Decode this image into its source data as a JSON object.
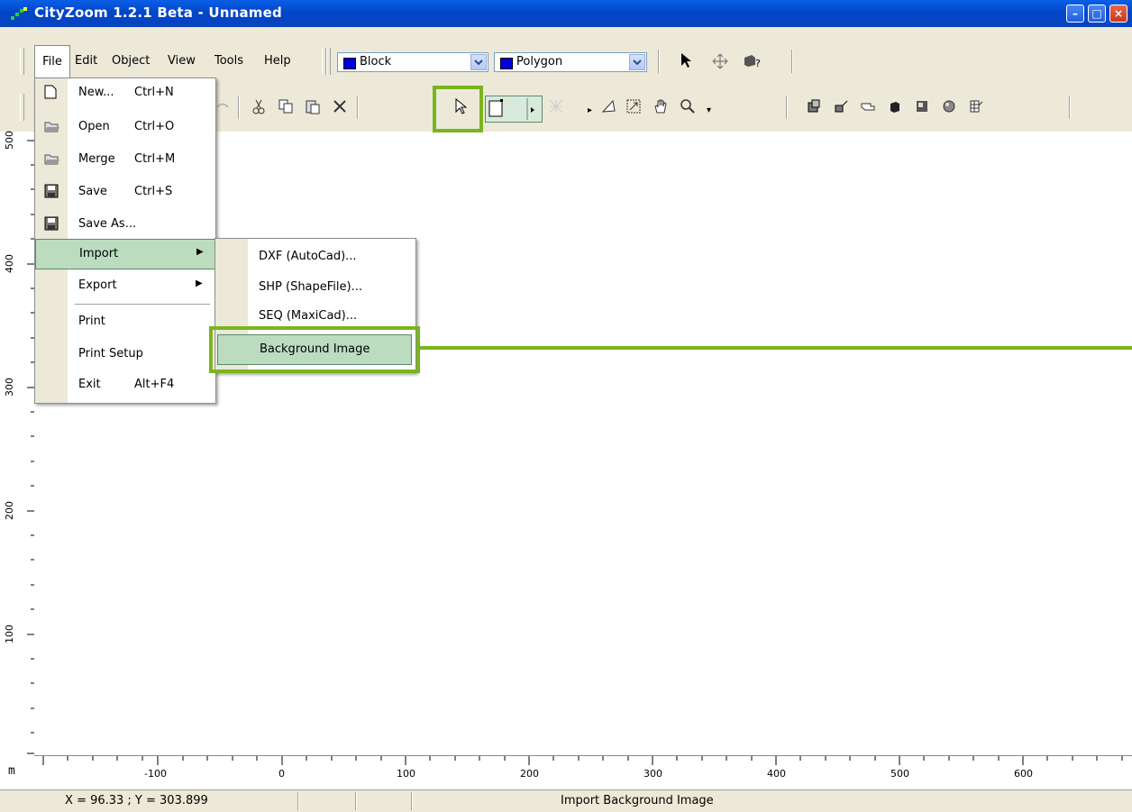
{
  "window": {
    "title": "CityZoom 1.2.1 Beta - Unnamed",
    "minimize": "–",
    "maximize": "□",
    "close": "×"
  },
  "menubar": {
    "items": [
      {
        "label": "File"
      },
      {
        "label": "Edit"
      },
      {
        "label": "Object"
      },
      {
        "label": "View"
      },
      {
        "label": "Tools"
      },
      {
        "label": "Help"
      }
    ]
  },
  "combos": {
    "object_type": {
      "value": "Block",
      "swatch": "#0000e0"
    },
    "shape_type": {
      "value": "Polygon",
      "swatch": "#0000e0"
    }
  },
  "file_menu": [
    {
      "label": "New...",
      "shortcut": "Ctrl+N",
      "icon": "new-document-icon"
    },
    {
      "label": "Open",
      "shortcut": "Ctrl+O",
      "icon": "folder-open-icon"
    },
    {
      "label": "Merge",
      "shortcut": "Ctrl+M",
      "icon": "folder-merge-icon"
    },
    {
      "label": "Save",
      "shortcut": "Ctrl+S",
      "icon": "floppy-save-icon"
    },
    {
      "label": "Save As...",
      "shortcut": "",
      "icon": "floppy-save-as-icon"
    },
    {
      "label": "Import",
      "shortcut": "",
      "icon": ""
    },
    {
      "label": "Export",
      "shortcut": "",
      "icon": ""
    },
    {
      "label": "Print",
      "shortcut": "",
      "icon": ""
    },
    {
      "label": "Print Setup",
      "shortcut": "",
      "icon": ""
    },
    {
      "label": "Exit",
      "shortcut": "Alt+F4",
      "icon": ""
    }
  ],
  "import_submenu": [
    {
      "label": "DXF (AutoCad)..."
    },
    {
      "label": "SHP (ShapeFile)..."
    },
    {
      "label": "SEQ (MaxiCad)..."
    },
    {
      "label": "Background Image"
    }
  ],
  "rulers": {
    "unit": "m",
    "y_labels": [
      "500",
      "400",
      "300",
      "200",
      "100"
    ],
    "x_labels": [
      "-100",
      "0",
      "100",
      "200",
      "300",
      "400",
      "500",
      "600"
    ]
  },
  "status": {
    "coords": "X = 96.33 ;  Y = 303.899",
    "message": "Import Background Image"
  },
  "colors": {
    "highlight_green": "#7ab51d",
    "menu_highlight": "#bcdcc0",
    "titlebar_blue": "#0a5fe6"
  }
}
